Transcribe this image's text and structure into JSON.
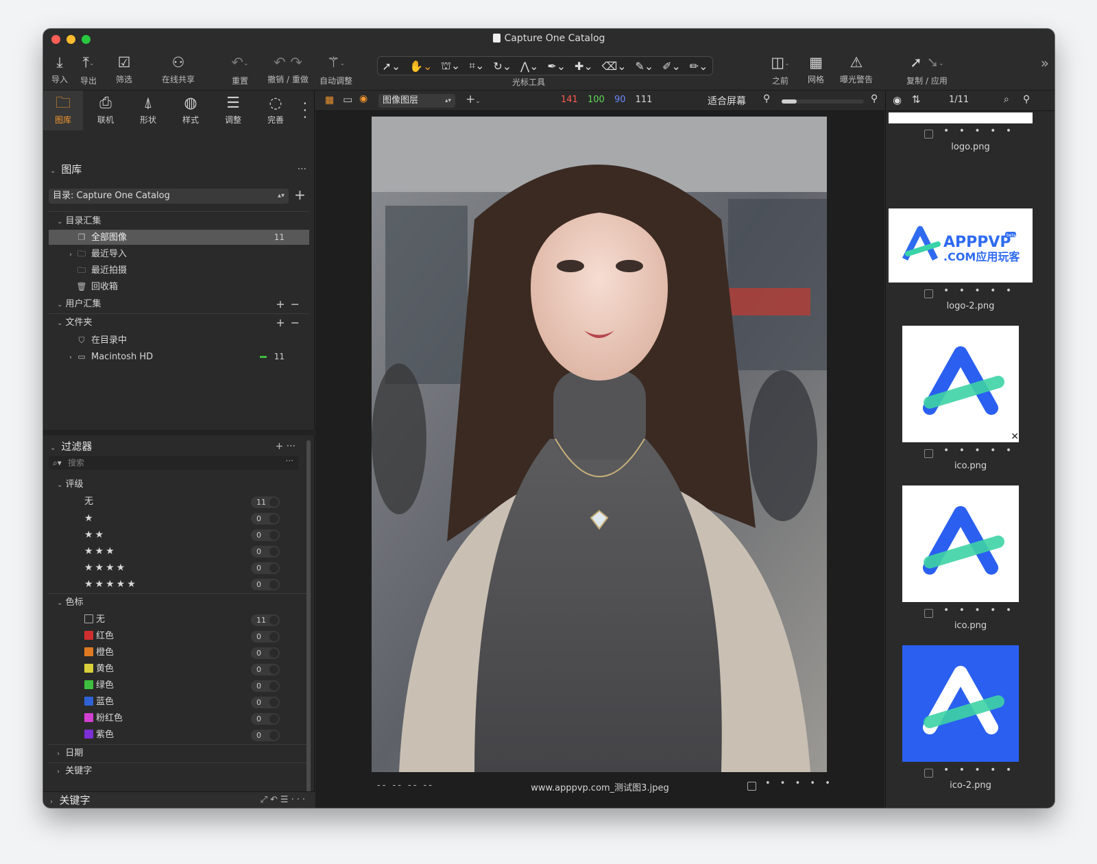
{
  "window": {
    "title": "Capture One Catalog",
    "traffic": {
      "close": "#fe5f57",
      "minimize": "#febc2e",
      "zoom": "#28c840"
    }
  },
  "toolbar": {
    "import": "导入",
    "export": "导出",
    "filter": "筛选",
    "share": "在线共享",
    "reset": "重置",
    "undo_redo": "撤销 / 重做",
    "auto_adjust": "自动调整",
    "cursor_tools": "光标工具",
    "before": "之前",
    "grid": "网格",
    "exposure_warning": "曝光警告",
    "copy_apply": "复制 / 应用"
  },
  "left_tabs": [
    {
      "label": "图库",
      "icon": "folder-icon"
    },
    {
      "label": "联机",
      "icon": "camera-icon"
    },
    {
      "label": "形状",
      "icon": "lens-icon"
    },
    {
      "label": "样式",
      "icon": "styles-icon"
    },
    {
      "label": "调整",
      "icon": "sliders-icon"
    },
    {
      "label": "完善",
      "icon": "refine-icon"
    }
  ],
  "library": {
    "title": "图库",
    "catalog_select": "目录: Capture One Catalog",
    "catalog_collections": "目录汇集",
    "items": [
      {
        "label": "全部图像",
        "count": "11"
      },
      {
        "label": "最近导入"
      },
      {
        "label": "最近拍摄"
      },
      {
        "label": "回收箱"
      }
    ],
    "user_collections": "用户汇集",
    "folders": "文件夹",
    "folder_items": [
      {
        "label": "在目录中"
      },
      {
        "label": "Macintosh HD",
        "count": "11"
      }
    ]
  },
  "filters": {
    "title": "过滤器",
    "search_placeholder": "搜索",
    "rating_title": "评级",
    "ratings": [
      {
        "label": "无",
        "stars": "",
        "count": "11"
      },
      {
        "label": "",
        "stars": "★",
        "count": "0"
      },
      {
        "label": "",
        "stars": "★★",
        "count": "0"
      },
      {
        "label": "",
        "stars": "★★★",
        "count": "0"
      },
      {
        "label": "",
        "stars": "★★★★",
        "count": "0"
      },
      {
        "label": "",
        "stars": "★★★★★",
        "count": "0"
      }
    ],
    "color_title": "色标",
    "colors": [
      {
        "label": "无",
        "color": "none",
        "count": "11"
      },
      {
        "label": "红色",
        "color": "#d12f2f",
        "count": "0"
      },
      {
        "label": "橙色",
        "color": "#e07a22",
        "count": "0"
      },
      {
        "label": "黄色",
        "color": "#d8cf3a",
        "count": "0"
      },
      {
        "label": "绿色",
        "color": "#3fbf3f",
        "count": "0"
      },
      {
        "label": "蓝色",
        "color": "#2f62d6",
        "count": "0"
      },
      {
        "label": "粉红色",
        "color": "#d23fd1",
        "count": "0"
      },
      {
        "label": "紫色",
        "color": "#7d2fd6",
        "count": "0"
      }
    ],
    "date_title": "日期",
    "keyword_title": "关键字"
  },
  "bottom_panel": {
    "title": "关键字"
  },
  "viewer": {
    "layer_select": "图像图层",
    "rgb": {
      "r": "141",
      "g": "100",
      "b": "90",
      "l": "111"
    },
    "fit": "适合屏幕",
    "filename": "www.apppvp.com_测试图3.jpeg",
    "exif_dashes": "--   --   --   --"
  },
  "browser": {
    "count": "1/11",
    "items": [
      {
        "name": "logo.png"
      },
      {
        "name": "logo-2.png",
        "logo_text_1": "APPPVP",
        "logo_text_2": ".COM应用玩客",
        "badge": "beta"
      },
      {
        "name": "ico.png"
      },
      {
        "name": "ico.png"
      },
      {
        "name": "ico-2.png"
      }
    ]
  },
  "accent": "#f2962d"
}
